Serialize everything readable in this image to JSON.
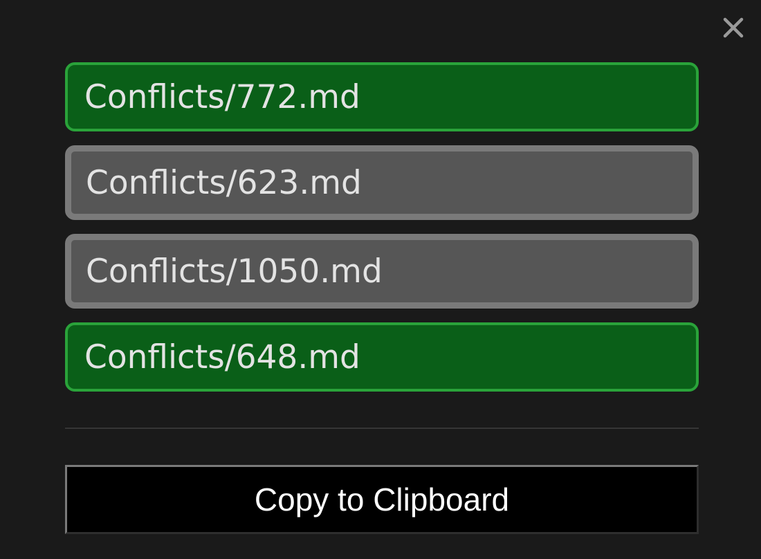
{
  "colors": {
    "background": "#1a1a1a",
    "selected_fill": "#0a5f18",
    "selected_border": "#2aa33a",
    "unselected_fill": "#565656",
    "unselected_border": "#7a7a7a",
    "text": "#e3e3e3",
    "button_fill": "#000000",
    "button_text": "#ffffff"
  },
  "close": {
    "icon": "close-icon"
  },
  "files": [
    {
      "label": "Conflicts/772.md",
      "selected": true
    },
    {
      "label": "Conflicts/623.md",
      "selected": false
    },
    {
      "label": "Conflicts/1050.md",
      "selected": false
    },
    {
      "label": "Conflicts/648.md",
      "selected": true
    }
  ],
  "actions": {
    "copy_label": "Copy to Clipboard"
  }
}
